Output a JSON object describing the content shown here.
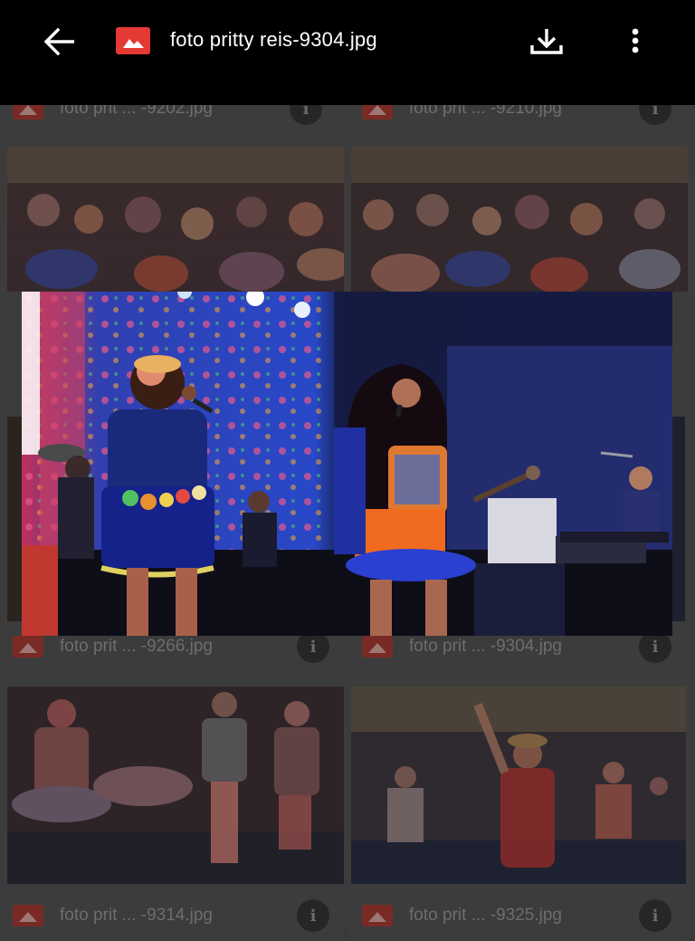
{
  "topbar": {
    "title": "foto pritty reis-9304.jpg"
  },
  "icons": {
    "back": "arrow-back-icon",
    "app": "image-file-icon",
    "download": "download-icon",
    "more": "more-vert-icon",
    "info": "info-icon"
  },
  "grid": {
    "rows": [
      {
        "left": "foto prit ... -9202.jpg",
        "right": "foto prit ... -9210.jpg"
      },
      {
        "left": "foto prit ... -9266.jpg",
        "right": "foto prit ... -9304.jpg"
      },
      {
        "left": "foto prit ... -9314.jpg",
        "right": "foto prit ... -9325.jpg"
      }
    ],
    "info_glyph": "i"
  },
  "viewer": {
    "image_name": "foto pritty reis-9304.jpg"
  },
  "colors": {
    "topbar_bg": "#000000",
    "accent_red": "#e53935",
    "dim_overlay": "#3c3c3c"
  }
}
